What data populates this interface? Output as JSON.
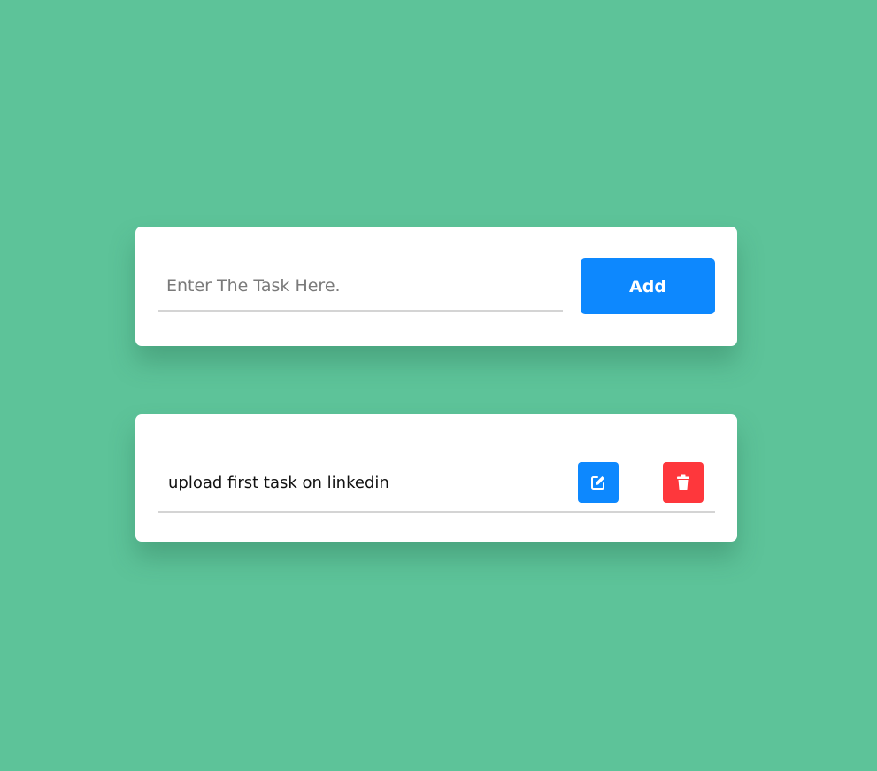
{
  "colors": {
    "background": "#5dc399",
    "card": "#ffffff",
    "primary": "#0d88fe",
    "danger": "#fe373c"
  },
  "form": {
    "input_value": "",
    "input_placeholder": "Enter The Task Here.",
    "add_label": "Add"
  },
  "tasks": [
    {
      "text": "upload first task on linkedin",
      "edit_icon": "edit-icon",
      "delete_icon": "trash-icon"
    }
  ]
}
